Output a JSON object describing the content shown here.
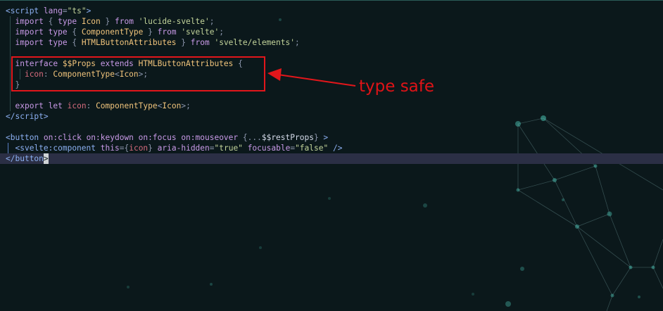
{
  "code": {
    "lines": [
      [
        {
          "t": "<",
          "c": "tag"
        },
        {
          "t": "script",
          "c": "tag"
        },
        {
          "t": " ",
          "c": "plain"
        },
        {
          "t": "lang",
          "c": "attr"
        },
        {
          "t": "=",
          "c": "punc"
        },
        {
          "t": "\"ts\"",
          "c": "str"
        },
        {
          "t": ">",
          "c": "tag"
        }
      ],
      [
        {
          "t": "  ",
          "c": "plain"
        },
        {
          "t": "import",
          "c": "kw"
        },
        {
          "t": " { ",
          "c": "punc"
        },
        {
          "t": "type",
          "c": "kw"
        },
        {
          "t": " ",
          "c": "plain"
        },
        {
          "t": "Icon",
          "c": "ty"
        },
        {
          "t": " } ",
          "c": "punc"
        },
        {
          "t": "from",
          "c": "kw"
        },
        {
          "t": " ",
          "c": "plain"
        },
        {
          "t": "'lucide-svelte'",
          "c": "str"
        },
        {
          "t": ";",
          "c": "punc"
        }
      ],
      [
        {
          "t": "  ",
          "c": "plain"
        },
        {
          "t": "import",
          "c": "kw"
        },
        {
          "t": " ",
          "c": "plain"
        },
        {
          "t": "type",
          "c": "kw"
        },
        {
          "t": " { ",
          "c": "punc"
        },
        {
          "t": "ComponentType",
          "c": "ty"
        },
        {
          "t": " } ",
          "c": "punc"
        },
        {
          "t": "from",
          "c": "kw"
        },
        {
          "t": " ",
          "c": "plain"
        },
        {
          "t": "'svelte'",
          "c": "str"
        },
        {
          "t": ";",
          "c": "punc"
        }
      ],
      [
        {
          "t": "  ",
          "c": "plain"
        },
        {
          "t": "import",
          "c": "kw"
        },
        {
          "t": " ",
          "c": "plain"
        },
        {
          "t": "type",
          "c": "kw"
        },
        {
          "t": " { ",
          "c": "punc"
        },
        {
          "t": "HTMLButtonAttributes",
          "c": "ty"
        },
        {
          "t": " } ",
          "c": "punc"
        },
        {
          "t": "from",
          "c": "kw"
        },
        {
          "t": " ",
          "c": "plain"
        },
        {
          "t": "'svelte/elements'",
          "c": "str"
        },
        {
          "t": ";",
          "c": "punc"
        }
      ],
      [],
      [
        {
          "t": "  ",
          "c": "plain"
        },
        {
          "t": "interface",
          "c": "kw"
        },
        {
          "t": " ",
          "c": "plain"
        },
        {
          "t": "$$Props",
          "c": "ty"
        },
        {
          "t": " ",
          "c": "plain"
        },
        {
          "t": "extends",
          "c": "kw"
        },
        {
          "t": " ",
          "c": "plain"
        },
        {
          "t": "HTMLButtonAttributes",
          "c": "ty"
        },
        {
          "t": " {",
          "c": "punc"
        }
      ],
      [
        {
          "t": "    ",
          "c": "plain"
        },
        {
          "t": "icon",
          "c": "var"
        },
        {
          "t": ": ",
          "c": "punc"
        },
        {
          "t": "ComponentType",
          "c": "ty"
        },
        {
          "t": "<",
          "c": "punc"
        },
        {
          "t": "Icon",
          "c": "ty"
        },
        {
          "t": ">;",
          "c": "punc"
        }
      ],
      [
        {
          "t": "  }",
          "c": "punc"
        }
      ],
      [],
      [
        {
          "t": "  ",
          "c": "plain"
        },
        {
          "t": "export",
          "c": "kw"
        },
        {
          "t": " ",
          "c": "plain"
        },
        {
          "t": "let",
          "c": "kw"
        },
        {
          "t": " ",
          "c": "plain"
        },
        {
          "t": "icon",
          "c": "var"
        },
        {
          "t": ": ",
          "c": "punc"
        },
        {
          "t": "ComponentType",
          "c": "ty"
        },
        {
          "t": "<",
          "c": "punc"
        },
        {
          "t": "Icon",
          "c": "ty"
        },
        {
          "t": ">;",
          "c": "punc"
        }
      ],
      [
        {
          "t": "</",
          "c": "tag"
        },
        {
          "t": "script",
          "c": "tag"
        },
        {
          "t": ">",
          "c": "tag"
        }
      ],
      [],
      [
        {
          "t": "<",
          "c": "tag"
        },
        {
          "t": "button",
          "c": "tag"
        },
        {
          "t": " ",
          "c": "plain"
        },
        {
          "t": "on:click",
          "c": "attr"
        },
        {
          "t": " ",
          "c": "plain"
        },
        {
          "t": "on:keydown",
          "c": "attr"
        },
        {
          "t": " ",
          "c": "plain"
        },
        {
          "t": "on:focus",
          "c": "attr"
        },
        {
          "t": " ",
          "c": "plain"
        },
        {
          "t": "on:mouseover",
          "c": "attr"
        },
        {
          "t": " {",
          "c": "punc"
        },
        {
          "t": "...",
          "c": "punc"
        },
        {
          "t": "$$restProps",
          "c": "ident"
        },
        {
          "t": "}",
          "c": "punc"
        },
        {
          "t": " >",
          "c": "tag"
        }
      ],
      [
        {
          "t": "  ",
          "c": "plain"
        },
        {
          "t": "<",
          "c": "tag"
        },
        {
          "t": "svelte:component",
          "c": "tag"
        },
        {
          "t": " ",
          "c": "plain"
        },
        {
          "t": "this",
          "c": "attr"
        },
        {
          "t": "=",
          "c": "punc"
        },
        {
          "t": "{",
          "c": "punc"
        },
        {
          "t": "icon",
          "c": "var"
        },
        {
          "t": "}",
          "c": "punc"
        },
        {
          "t": " ",
          "c": "plain"
        },
        {
          "t": "aria-hidden",
          "c": "attr"
        },
        {
          "t": "=",
          "c": "punc"
        },
        {
          "t": "\"true\"",
          "c": "str"
        },
        {
          "t": " ",
          "c": "plain"
        },
        {
          "t": "focusable",
          "c": "attr"
        },
        {
          "t": "=",
          "c": "punc"
        },
        {
          "t": "\"false\"",
          "c": "str"
        },
        {
          "t": " />",
          "c": "tag"
        }
      ],
      [
        {
          "t": "</",
          "c": "tag"
        },
        {
          "t": "button",
          "c": "tag"
        },
        {
          "t": ">",
          "c": "cursor"
        }
      ]
    ]
  },
  "annotation": {
    "label": "type safe",
    "color": "#e01317"
  },
  "theme": {
    "background": "#0b181b",
    "current_line": "#2b2f45"
  }
}
